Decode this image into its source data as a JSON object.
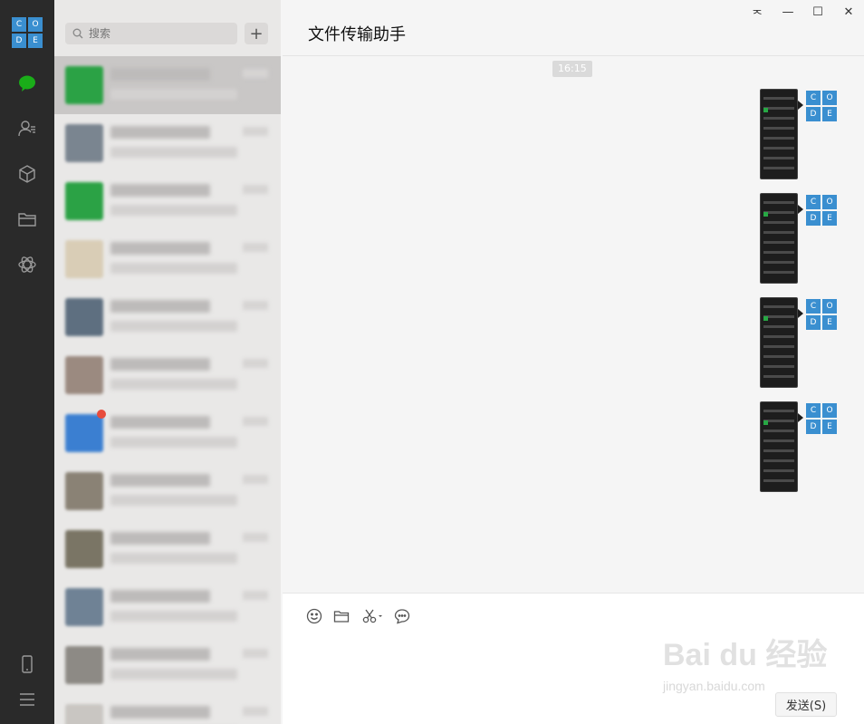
{
  "window": {
    "title": "文件传输助手",
    "controls": [
      "pin",
      "minimize",
      "maximize",
      "close"
    ]
  },
  "profile": {
    "letters": [
      "C",
      "O",
      "D",
      "E"
    ],
    "color": "#3a8fd0"
  },
  "rail": {
    "items": [
      "chat-icon",
      "contacts-icon",
      "favorites-icon",
      "files-icon",
      "mini-programs-icon"
    ],
    "bottom": [
      "phone-icon",
      "menu-icon"
    ],
    "active_color": "#1aad19"
  },
  "search": {
    "placeholder": "搜索",
    "add_label": "+"
  },
  "chat_list": {
    "items": [
      {
        "avatar_color": "#2ba245",
        "active": true
      },
      {
        "avatar_color": "#7a8590",
        "active": false
      },
      {
        "avatar_color": "#2ba245",
        "active": false
      },
      {
        "avatar_color": "#d9cdb6",
        "active": false
      },
      {
        "avatar_color": "#5e6f80",
        "active": false
      },
      {
        "avatar_color": "#9b8a80",
        "active": false
      },
      {
        "avatar_color": "#3b7fd1",
        "active": false,
        "badge": true
      },
      {
        "avatar_color": "#8a8275",
        "active": false
      },
      {
        "avatar_color": "#7a7565",
        "active": false
      },
      {
        "avatar_color": "#6f8295",
        "active": false
      },
      {
        "avatar_color": "#8d8a85",
        "active": false
      },
      {
        "avatar_color": "#c9c6c2",
        "active": false
      }
    ]
  },
  "chat": {
    "timestamp": "16:15",
    "messages": [
      {
        "type": "image"
      },
      {
        "type": "image"
      },
      {
        "type": "image"
      },
      {
        "type": "image"
      }
    ]
  },
  "toolbar": {
    "tools": [
      "emoji-icon",
      "folder-icon",
      "scissors-icon",
      "chat-history-icon"
    ]
  },
  "send_label": "发送(S)",
  "watermark": {
    "main": "Bai du 经验",
    "sub": "jingyan.baidu.com"
  }
}
